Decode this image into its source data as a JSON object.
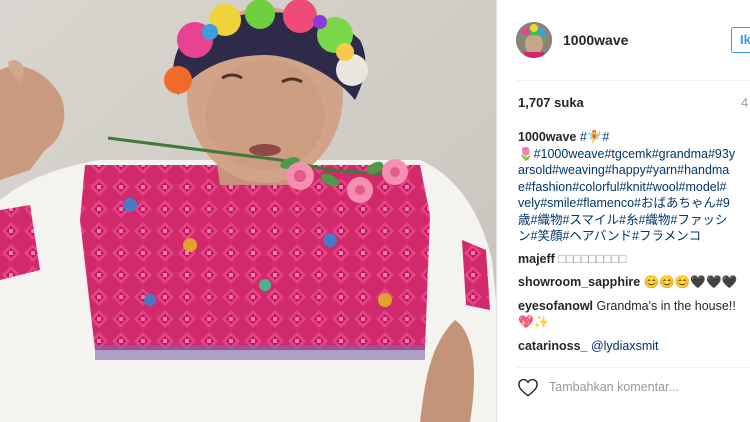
{
  "post": {
    "username": "1000wave",
    "follow_label": "Ik",
    "likes": "1,707 suka",
    "time_ago": "4",
    "caption": {
      "user": "1000wave",
      "tags": "#🧚#\n🌷#1000weave#tgcemk#grandma#93y\narsold#weaving#happy#yarn#handma\ne#fashion#colorful#knit#wool#model#\nvely#smile#flamenco#おばあちゃん#9\n歳#織物#スマイル#糸#織物#ファッシ\nン#笑顔#ヘアバンド#フラメンコ"
    },
    "comments": [
      {
        "user": "majeff",
        "text": "□□□□□□□□□"
      },
      {
        "user": "showroom_sapphire",
        "text": "😊😊😊🖤🖤🖤"
      },
      {
        "user": "eyesofanowl",
        "text": "Grandma's in the house!!",
        "text2": "💖✨"
      },
      {
        "user": "catarinoss_",
        "text": "@lydiaxsmit"
      }
    ],
    "add_comment_placeholder": "Tambahkan komentar..."
  },
  "icons": {
    "heart": "heart-icon"
  },
  "colors": {
    "link": "#003569",
    "accent": "#3897f0",
    "muted": "#999999"
  }
}
